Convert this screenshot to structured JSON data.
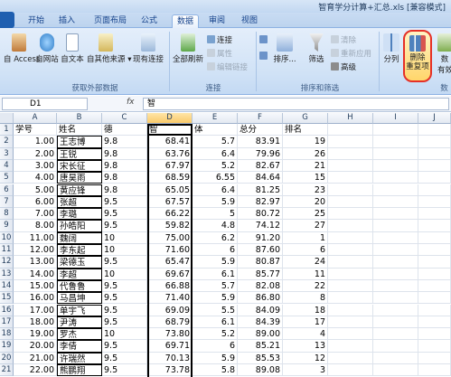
{
  "window": {
    "title": "智育学分计算+汇总.xls  [兼容模式]"
  },
  "tabs": [
    {
      "label": "开始",
      "active": false
    },
    {
      "label": "插入",
      "active": false
    },
    {
      "label": "页面布局",
      "active": false
    },
    {
      "label": "公式",
      "active": false
    },
    {
      "label": "数据",
      "active": true
    },
    {
      "label": "审阅",
      "active": false
    },
    {
      "label": "视图",
      "active": false
    }
  ],
  "ribbon": {
    "get_external": {
      "label": "获取外部数据",
      "access": "自 Access",
      "web": "自网站",
      "text": "自文本",
      "other": "自其他来源",
      "existing": "现有连接"
    },
    "connections": {
      "label": "连接",
      "refresh_all": "全部刷新",
      "connections": "连接",
      "properties": "属性",
      "edit_links": "编辑链接"
    },
    "sort_filter": {
      "label": "排序和筛选",
      "sort": "排序...",
      "filter": "筛选",
      "clear": "清除",
      "reapply": "重新应用",
      "advanced": "高级"
    },
    "data_tools": {
      "label": "数",
      "split": "分列",
      "remove_dup_1": "删除",
      "remove_dup_2": "重复项",
      "validate_1": "数",
      "validate_2": "有效"
    }
  },
  "formula_bar": {
    "name_box": "D1",
    "fx": "fx",
    "content": "智"
  },
  "columns": [
    "A",
    "B",
    "C",
    "D",
    "E",
    "F",
    "G",
    "H",
    "I",
    "J"
  ],
  "selected_column": "D",
  "rows": [
    {
      "n": "1",
      "a": "学号",
      "b": "姓名",
      "c": "德",
      "d": "智",
      "e": "体",
      "f": "总分",
      "g": "排名"
    },
    {
      "n": "2",
      "a": "1.00",
      "b": "王志博",
      "c": "9.8",
      "d": "68.41",
      "e": "5.7",
      "f": "83.91",
      "g": "19"
    },
    {
      "n": "3",
      "a": "2.00",
      "b": "王锐",
      "c": "9.8",
      "d": "63.76",
      "e": "6.4",
      "f": "79.96",
      "g": "26"
    },
    {
      "n": "4",
      "a": "3.00",
      "b": "宋长征",
      "c": "9.8",
      "d": "67.97",
      "e": "5.2",
      "f": "82.67",
      "g": "21"
    },
    {
      "n": "5",
      "a": "4.00",
      "b": "唐昊雨",
      "c": "9.8",
      "d": "68.59",
      "e": "6.55",
      "f": "84.64",
      "g": "15"
    },
    {
      "n": "6",
      "a": "5.00",
      "b": "黄应锋",
      "c": "9.8",
      "d": "65.05",
      "e": "6.4",
      "f": "81.25",
      "g": "23"
    },
    {
      "n": "7",
      "a": "6.00",
      "b": "张超",
      "c": "9.5",
      "d": "67.57",
      "e": "5.9",
      "f": "82.97",
      "g": "20"
    },
    {
      "n": "8",
      "a": "7.00",
      "b": "李璐",
      "c": "9.5",
      "d": "66.22",
      "e": "5",
      "f": "80.72",
      "g": "25"
    },
    {
      "n": "9",
      "a": "8.00",
      "b": "孙皓阳",
      "c": "9.5",
      "d": "59.82",
      "e": "4.8",
      "f": "74.12",
      "g": "27"
    },
    {
      "n": "10",
      "a": "11.00",
      "b": "魏阔",
      "c": "10",
      "d": "75.00",
      "e": "6.2",
      "f": "91.20",
      "g": "1"
    },
    {
      "n": "11",
      "a": "12.00",
      "b": "李东起",
      "c": "10",
      "d": "71.60",
      "e": "6",
      "f": "87.60",
      "g": "6"
    },
    {
      "n": "12",
      "a": "13.00",
      "b": "梁德玉",
      "c": "9.5",
      "d": "65.47",
      "e": "5.9",
      "f": "80.87",
      "g": "24"
    },
    {
      "n": "13",
      "a": "14.00",
      "b": "李超",
      "c": "10",
      "d": "69.67",
      "e": "6.1",
      "f": "85.77",
      "g": "11"
    },
    {
      "n": "14",
      "a": "15.00",
      "b": "代鲁鲁",
      "c": "9.5",
      "d": "66.88",
      "e": "5.7",
      "f": "82.08",
      "g": "22"
    },
    {
      "n": "15",
      "a": "16.00",
      "b": "马昌坤",
      "c": "9.5",
      "d": "71.40",
      "e": "5.9",
      "f": "86.80",
      "g": "8"
    },
    {
      "n": "16",
      "a": "17.00",
      "b": "单宇飞",
      "c": "9.5",
      "d": "69.09",
      "e": "5.5",
      "f": "84.09",
      "g": "18"
    },
    {
      "n": "17",
      "a": "18.00",
      "b": "尹涛",
      "c": "9.5",
      "d": "68.79",
      "e": "6.1",
      "f": "84.39",
      "g": "17"
    },
    {
      "n": "18",
      "a": "19.00",
      "b": "罗杰",
      "c": "10",
      "d": "73.80",
      "e": "5.2",
      "f": "89.00",
      "g": "4"
    },
    {
      "n": "19",
      "a": "20.00",
      "b": "李倩",
      "c": "9.5",
      "d": "69.71",
      "e": "6",
      "f": "85.21",
      "g": "13"
    },
    {
      "n": "20",
      "a": "21.00",
      "b": "许瑞然",
      "c": "9.5",
      "d": "70.13",
      "e": "5.9",
      "f": "85.53",
      "g": "12"
    },
    {
      "n": "21",
      "a": "22.00",
      "b": "熊鹏翔",
      "c": "9.5",
      "d": "73.78",
      "e": "5.8",
      "f": "89.08",
      "g": "3"
    }
  ]
}
